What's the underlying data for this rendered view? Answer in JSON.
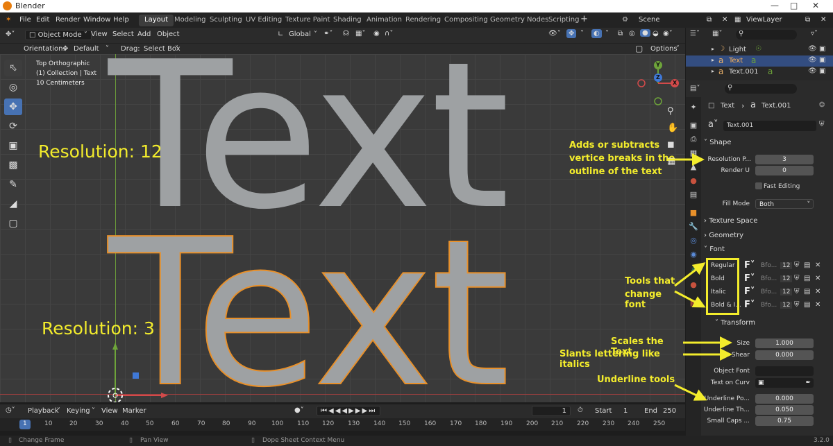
{
  "window": {
    "title": "Blender"
  },
  "menu": [
    "File",
    "Edit",
    "Render",
    "Window",
    "Help"
  ],
  "workspaces": [
    "Layout",
    "Modeling",
    "Sculpting",
    "UV Editing",
    "Texture Paint",
    "Shading",
    "Animation",
    "Rendering",
    "Compositing",
    "Geometry Nodes",
    "Scripting"
  ],
  "scene": "Scene",
  "view_layer": "ViewLayer",
  "viewport_header": {
    "mode": "Object Mode",
    "view": "View",
    "select": "Select",
    "add": "Add",
    "object": "Object",
    "transform": "Global"
  },
  "header2": {
    "orientation_label": "Orientation:",
    "orientation_value": "Default",
    "drag_label": "Drag:",
    "drag_value": "Select Box",
    "options": "Options"
  },
  "overlay": {
    "line1": "Top Orthographic",
    "line2": "(1) Collection | Text",
    "line3": "10 Centimeters"
  },
  "canvas_text": {
    "top": "Text",
    "bottom": "Text"
  },
  "annotations": {
    "res12": "Resolution: 12",
    "res3": "Resolution: 3",
    "vertice_1": "Adds or subtracts",
    "vertice_2": "vertice breaks in the",
    "vertice_3": "outline of the text",
    "font_1": "Tools that",
    "font_2": "change font",
    "scales": "Scales the Text",
    "slants": "Slants lettering like italics",
    "underline": "Underline tools"
  },
  "gizmo": {
    "y": "Y",
    "z": "Z",
    "x": "X"
  },
  "outliner": [
    {
      "label": "Light",
      "selected": false
    },
    {
      "label": "Text",
      "selected": true
    },
    {
      "label": "Text.001",
      "selected": false
    }
  ],
  "properties": {
    "breadcrumb_obj": "Text",
    "breadcrumb_data": "Text.001",
    "datablock": "Text.001",
    "shape": {
      "header": "Shape",
      "resolution_label": "Resolution P...",
      "resolution_value": "3",
      "render_label": "Render U",
      "render_value": "0",
      "fast_editing": "Fast Editing",
      "fill_label": "Fill Mode",
      "fill_value": "Both"
    },
    "texture_space": "Texture Space",
    "geometry": "Geometry",
    "font": {
      "header": "Font",
      "rows": [
        {
          "label": "Regular",
          "name": "Bfo...",
          "users": "12"
        },
        {
          "label": "Bold",
          "name": "Bfo...",
          "users": "12"
        },
        {
          "label": "Italic",
          "name": "Bfo...",
          "users": "12"
        },
        {
          "label": "Bold & I...",
          "name": "Bfo...",
          "users": "12"
        }
      ]
    },
    "transform": {
      "header": "Transform",
      "size_label": "Size",
      "size_value": "1.000",
      "shear_label": "Shear",
      "shear_value": "0.000",
      "object_font_label": "Object Font",
      "text_on_curve_label": "Text on Curv",
      "underline_pos_label": "Underline Po...",
      "underline_pos_value": "0.000",
      "underline_th_label": "Underline Th...",
      "underline_th_value": "0.050",
      "small_caps_label": "Small Caps ...",
      "small_caps_value": "0.75"
    }
  },
  "timeline": {
    "playback": "Playback",
    "keying": "Keying",
    "view": "View",
    "marker": "Marker",
    "current": "1",
    "start_label": "Start",
    "start": "1",
    "end_label": "End",
    "end": "250"
  },
  "ruler": [
    "1",
    "10",
    "20",
    "30",
    "40",
    "50",
    "60",
    "70",
    "80",
    "90",
    "100",
    "110",
    "120",
    "130",
    "140",
    "150",
    "160",
    "170",
    "180",
    "190",
    "200",
    "210",
    "220",
    "230",
    "240",
    "250"
  ],
  "status": {
    "left": "Change Frame",
    "mid": "Pan View",
    "right": "Dope Sheet Context Menu",
    "version": "3.2.0"
  },
  "colors": {
    "accent": "#4772b3",
    "annotation": "#f3ec2c",
    "selected_outline": "#e8902a",
    "text_gray": "#9ea1a3"
  }
}
